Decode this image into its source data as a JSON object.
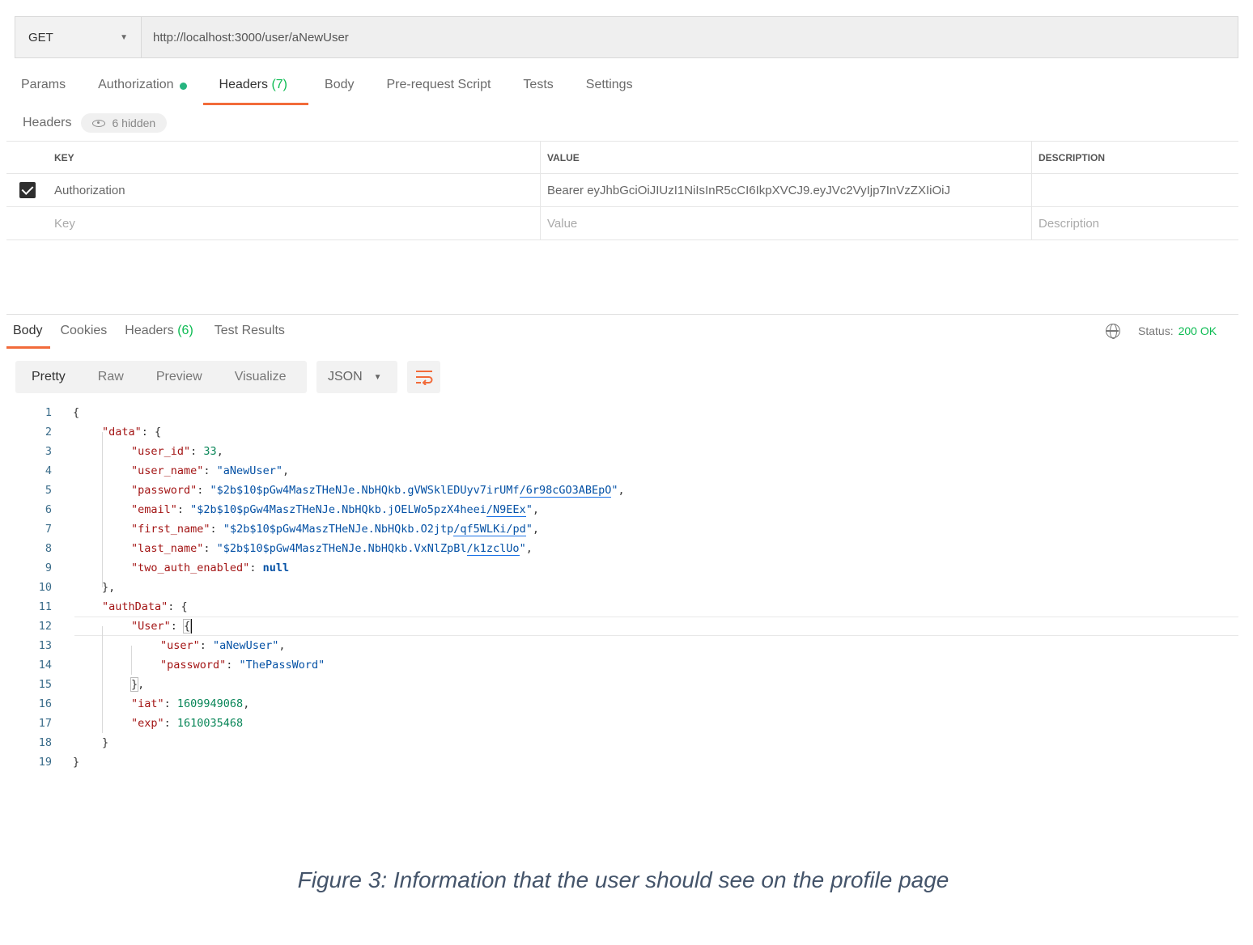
{
  "request": {
    "method": "GET",
    "url": "http://localhost:3000/user/aNewUser"
  },
  "request_tabs": {
    "params": "Params",
    "authorization": "Authorization",
    "headers": "Headers",
    "headers_count": "(7)",
    "body": "Body",
    "prerequest": "Pre-request Script",
    "tests": "Tests",
    "settings": "Settings"
  },
  "headers_panel": {
    "title": "Headers",
    "hidden": "6 hidden",
    "columns": {
      "key": "KEY",
      "value": "VALUE",
      "description": "DESCRIPTION"
    },
    "row": {
      "checked": true,
      "key": "Authorization",
      "value": "Bearer eyJhbGciOiJIUzI1NiIsInR5cCI6IkpXVCJ9.eyJVc2VyIjp7InVzZXIiOiJ",
      "description": ""
    },
    "placeholders": {
      "key": "Key",
      "value": "Value",
      "description": "Description"
    }
  },
  "response_tabs": {
    "body": "Body",
    "cookies": "Cookies",
    "headers": "Headers",
    "headers_count": "(6)",
    "test_results": "Test Results"
  },
  "status": {
    "label": "Status:",
    "value": "200 OK"
  },
  "view_modes": {
    "pretty": "Pretty",
    "raw": "Raw",
    "preview": "Preview",
    "visualize": "Visualize",
    "format": "JSON"
  },
  "code": {
    "line_numbers": [
      "1",
      "2",
      "3",
      "4",
      "5",
      "6",
      "7",
      "8",
      "9",
      "10",
      "11",
      "12",
      "13",
      "14",
      "15",
      "16",
      "17",
      "18",
      "19"
    ],
    "brace_open": "{",
    "brace_close": "}",
    "data_key": "\"data\"",
    "user_id_key": "\"user_id\"",
    "user_id_val": "33",
    "user_name_key": "\"user_name\"",
    "user_name_val": "\"aNewUser\"",
    "password_key": "\"password\"",
    "password_val_a": "\"$2b$10$pGw4MaszTHeNJe.NbHQkb.gVWSklEDUyv7irUMf",
    "password_val_b": "/6r98cGO3ABEpO",
    "email_key": "\"email\"",
    "email_val_a": "\"$2b$10$pGw4MaszTHeNJe.NbHQkb.jOELWo5pzX4heei",
    "email_val_b": "/N9EEx",
    "first_name_key": "\"first_name\"",
    "first_name_val_a": "\"$2b$10$pGw4MaszTHeNJe.NbHQkb.O2jtp",
    "first_name_val_b": "/qf5WLKi/pd",
    "last_name_key": "\"last_name\"",
    "last_name_val_a": "\"$2b$10$pGw4MaszTHeNJe.NbHQkb.VxNlZpBl",
    "last_name_val_b": "/k1zclUo",
    "two_auth_key": "\"two_auth_enabled\"",
    "two_auth_val": "null",
    "authdata_key": "\"authData\"",
    "user_obj_key": "\"User\"",
    "user_key": "\"user\"",
    "user_val": "\"aNewUser\"",
    "auth_password_key": "\"password\"",
    "auth_password_val": "\"ThePassWord\"",
    "iat_key": "\"iat\"",
    "iat_val": "1609949068",
    "exp_key": "\"exp\"",
    "exp_val": "1610035468"
  },
  "caption": "Figure 3: Information that the user should see on the profile page"
}
